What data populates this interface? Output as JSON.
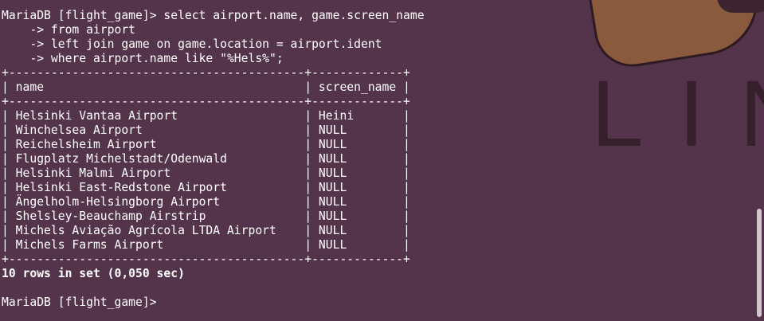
{
  "wallpaper": {
    "text": "LIN"
  },
  "terminal": {
    "query": [
      "MariaDB [flight_game]> select airport.name, game.screen_name",
      "    -> from airport",
      "    -> left join game on game.location = airport.ident",
      "    -> where airport.name like \"%Hels%\";"
    ],
    "table": {
      "border": "+------------------------------------------+-------------+",
      "header": "| name                                     | screen_name |",
      "rows": [
        "| Helsinki Vantaa Airport                  | Heini       |",
        "| Winchelsea Airport                       | NULL        |",
        "| Reichelsheim Airport                     | NULL        |",
        "| Flugplatz Michelstadt/Odenwald           | NULL        |",
        "| Helsinki Malmi Airport                   | NULL        |",
        "| Helsinki East-Redstone Airport           | NULL        |",
        "| Ängelholm-Helsingborg Airport            | NULL        |",
        "| Shelsley-Beauchamp Airstrip              | NULL        |",
        "| Michels Aviação Agrícola LTDA Airport    | NULL        |",
        "| Michels Farms Airport                    | NULL        |"
      ]
    },
    "result_summary": "10 rows in set (0,050 sec)",
    "prompt": "MariaDB [flight_game]> "
  }
}
